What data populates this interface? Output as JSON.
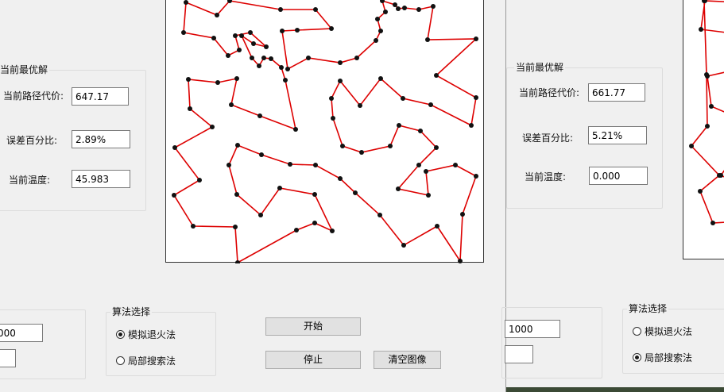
{
  "window_left": {
    "best_group": {
      "title": "当前最优解",
      "rows": [
        {
          "label": "当前路径代价:",
          "value": "647.17"
        },
        {
          "label": "误差百分比:",
          "value": "2.89%"
        },
        {
          "label": "当前温度:",
          "value": "45.983"
        }
      ]
    },
    "param_group": {
      "field1": "000",
      "field2": ""
    },
    "algo_group": {
      "title": "算法选择",
      "options": [
        {
          "label": "模拟退火法",
          "selected": true
        },
        {
          "label": "局部搜索法",
          "selected": false
        }
      ]
    },
    "buttons": {
      "start": "开始",
      "stop": "停止",
      "clear": "清空图像"
    }
  },
  "window_right": {
    "best_group": {
      "title": "当前最优解",
      "rows": [
        {
          "label": "当前路径代价:",
          "value": "661.77"
        },
        {
          "label": "误差百分比:",
          "value": "5.21%"
        },
        {
          "label": "当前温度:",
          "value": "0.000"
        }
      ]
    },
    "param_group": {
      "field1": "1000",
      "field2": ""
    },
    "algo_group": {
      "title": "算法选择",
      "options": [
        {
          "label": "模拟退火法",
          "selected": false
        },
        {
          "label": "局部搜索法",
          "selected": true
        }
      ]
    }
  },
  "colors": {
    "tour_edge": "#dd0000",
    "city_node": "#111111"
  }
}
